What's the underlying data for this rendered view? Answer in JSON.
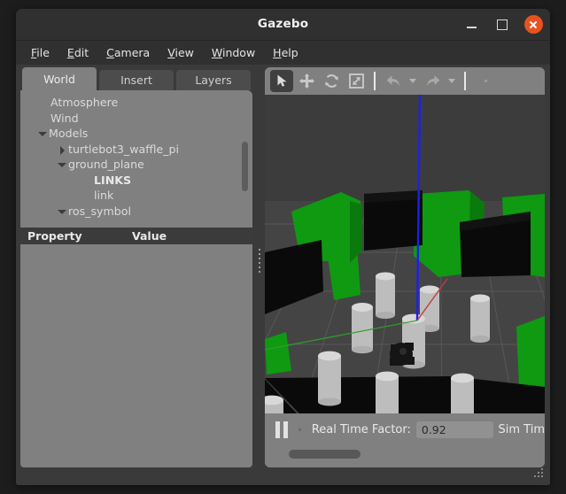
{
  "window": {
    "title": "Gazebo",
    "controls": {
      "minimize": "minimize",
      "maximize": "maximize",
      "close": "close"
    },
    "close_color": "#e8521f"
  },
  "menubar": {
    "items": [
      {
        "label": "File",
        "mnemonic": "F"
      },
      {
        "label": "Edit",
        "mnemonic": "E"
      },
      {
        "label": "Camera",
        "mnemonic": "C"
      },
      {
        "label": "View",
        "mnemonic": "V"
      },
      {
        "label": "Window",
        "mnemonic": "W"
      },
      {
        "label": "Help",
        "mnemonic": "H"
      }
    ]
  },
  "left_panel": {
    "tabs": [
      {
        "label": "World",
        "active": true
      },
      {
        "label": "Insert",
        "active": false
      },
      {
        "label": "Layers",
        "active": false
      }
    ],
    "tree": [
      {
        "label": "Atmosphere",
        "indent": 1,
        "arrow": "none",
        "bold": false
      },
      {
        "label": "Wind",
        "indent": 1,
        "arrow": "none",
        "bold": false
      },
      {
        "label": "Models",
        "indent": 0,
        "arrow": "down",
        "bold": false
      },
      {
        "label": "turtlebot3_waffle_pi",
        "indent": 1,
        "arrow": "right",
        "bold": false
      },
      {
        "label": "ground_plane",
        "indent": 1,
        "arrow": "down",
        "bold": false
      },
      {
        "label": "LINKS",
        "indent": 3,
        "arrow": "none",
        "bold": true
      },
      {
        "label": "link",
        "indent": 3,
        "arrow": "none",
        "bold": false
      },
      {
        "label": "ros_symbol",
        "indent": 1,
        "arrow": "down",
        "bold": false
      }
    ],
    "property_header": {
      "property": "Property",
      "value": "Value"
    }
  },
  "render_toolbar": {
    "buttons": [
      {
        "name": "select-mode",
        "icon": "cursor-arrow-icon",
        "active": true
      },
      {
        "name": "translate-mode",
        "icon": "move-icon",
        "active": false
      },
      {
        "name": "rotate-mode",
        "icon": "rotate-icon",
        "active": false
      },
      {
        "name": "scale-mode",
        "icon": "scale-icon",
        "active": false
      },
      {
        "name": "undo",
        "icon": "undo-arrow-icon",
        "active": false
      },
      {
        "name": "redo",
        "icon": "redo-arrow-icon",
        "active": false
      }
    ]
  },
  "status_bar": {
    "play_state": "paused",
    "real_time_factor_label": "Real Time Factor:",
    "real_time_factor_value": "0.92",
    "sim_time_label": "Sim Tim"
  },
  "scene": {
    "ground_color": "#414141",
    "grid_color": "#5a5a5a",
    "wall_color": "#090909",
    "symbol_color": "#0e9410",
    "cylinder_color": "#c6c6c6",
    "axis_z_color": "#1a1ae8",
    "axis_x_color": "#c03030",
    "axis_y_color": "#2f9b2f",
    "robot_color": "#161616"
  }
}
